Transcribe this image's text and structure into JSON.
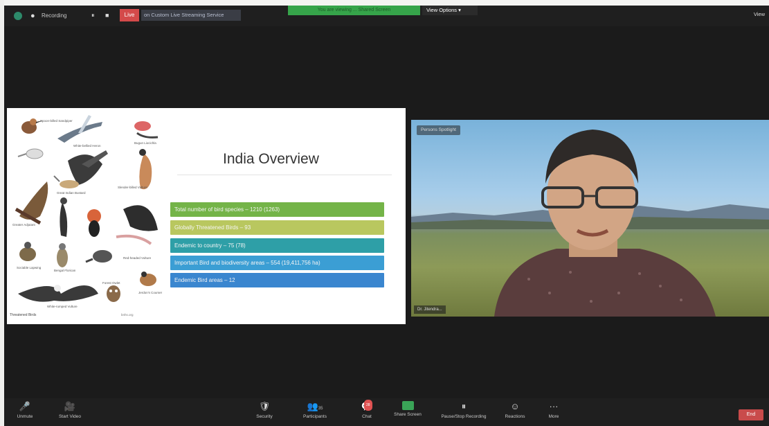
{
  "topbar": {
    "recording_label": "Recording",
    "pause_glyph": "⏸",
    "stop_glyph": "■",
    "live_label": "Live",
    "stream_label": "on Custom Live Streaming Service",
    "share_banner": "You are viewing ... Shared Screen",
    "view_options_label": "View Options ▾",
    "view_label": "View"
  },
  "slide": {
    "title": "India Overview",
    "bars": [
      {
        "text": "Total number of bird species – 1210 (1263)",
        "color": "#74b448"
      },
      {
        "text": "Globally Threatened Birds – 93",
        "color": "#b9c75f"
      },
      {
        "text": "Endemic to country – 75 (78)",
        "color": "#2e9fa7"
      },
      {
        "text": "Important Bird and biodiversity areas – 554 (19,411,756 ha)",
        "color": "#3b9ed4"
      },
      {
        "text": "Endemic Bird areas – 12",
        "color": "#3a86cf"
      }
    ],
    "footer_left": "Threatened Birds",
    "footer_right": "bnhs.org",
    "bird_labels": [
      "Spoon-billed Sandpiper",
      "White-bellied Heron",
      "Bugun Liocichla",
      "Great Indian Bustard",
      "Slender-billed Vulture",
      "Greater Adjutant",
      "Red-headed Vulture",
      "Sociable Lapwing",
      "White-rumped Vulture",
      "Forest Owlet",
      "Jerdon's Courser",
      "Bengal Florican"
    ]
  },
  "video": {
    "pinned_name": "Persons Spotlight",
    "participant_name": "Dr. Jitendra..."
  },
  "toolbar": {
    "items": [
      {
        "label": "Unmute",
        "icon": "🎤"
      },
      {
        "label": "Start Video",
        "icon": "🎥"
      },
      {
        "label": "Security",
        "icon": "🛡"
      },
      {
        "label": "Participants",
        "icon": "👥",
        "count": "35"
      },
      {
        "label": "Chat",
        "icon": "💬",
        "badge": "28"
      },
      {
        "label": "Share Screen",
        "icon": ""
      },
      {
        "label": "Pause/Stop Recording",
        "icon": "⏸"
      },
      {
        "label": "Reactions",
        "icon": "☺"
      },
      {
        "label": "More",
        "icon": "···"
      }
    ],
    "end_label": "End"
  },
  "colors": {
    "background": "#1b1b1b",
    "live": "#d44a4a",
    "share_green": "#3aa457",
    "end_red": "#c94b4b"
  }
}
